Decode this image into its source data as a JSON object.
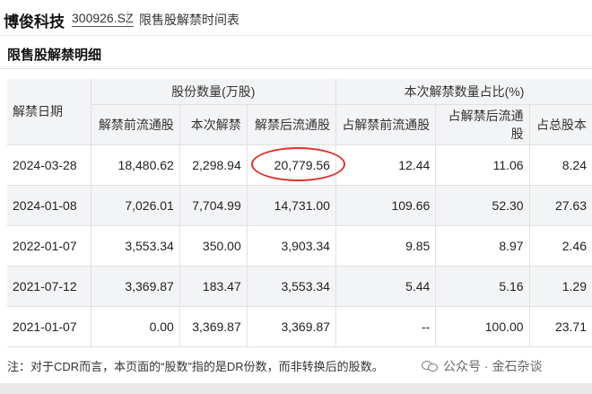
{
  "header": {
    "company": "博俊科技",
    "stock_code": "300926.SZ",
    "page_title": "限售股解禁时间表"
  },
  "section": {
    "title": "限售股解禁明细"
  },
  "table": {
    "group_headers": {
      "date": "解禁日期",
      "shares": "股份数量(万股)",
      "ratio": "本次解禁数量占比(%)"
    },
    "columns": [
      "解禁前流通股",
      "本次解禁",
      "解禁后流通股",
      "占解禁前流通股",
      "占解禁后流通股",
      "占总股本"
    ],
    "rows": [
      {
        "date": "2024-03-28",
        "pre": "18,480.62",
        "unlock": "2,298.94",
        "post": "20,779.56",
        "pct_pre": "12.44",
        "pct_post": "11.06",
        "pct_total": "8.24"
      },
      {
        "date": "2024-01-08",
        "pre": "7,026.01",
        "unlock": "7,704.99",
        "post": "14,731.00",
        "pct_pre": "109.66",
        "pct_post": "52.30",
        "pct_total": "27.63"
      },
      {
        "date": "2022-01-07",
        "pre": "3,553.34",
        "unlock": "350.00",
        "post": "3,903.34",
        "pct_pre": "9.85",
        "pct_post": "8.97",
        "pct_total": "2.46"
      },
      {
        "date": "2021-07-12",
        "pre": "3,369.87",
        "unlock": "183.47",
        "post": "3,553.34",
        "pct_pre": "5.44",
        "pct_post": "5.16",
        "pct_total": "1.29"
      },
      {
        "date": "2021-01-07",
        "pre": "0.00",
        "unlock": "3,369.87",
        "post": "3,369.87",
        "pct_pre": "--",
        "pct_post": "100.00",
        "pct_total": "23.71"
      }
    ]
  },
  "footnote": "注：对于CDR而言，本页面的“股数”指的是DR份数，而非转换后的股数。",
  "watermark": "公众号 · 金石杂谈",
  "colors": {
    "highlight_circle": "#e0302a",
    "header_bg": "#f3f4f6"
  }
}
